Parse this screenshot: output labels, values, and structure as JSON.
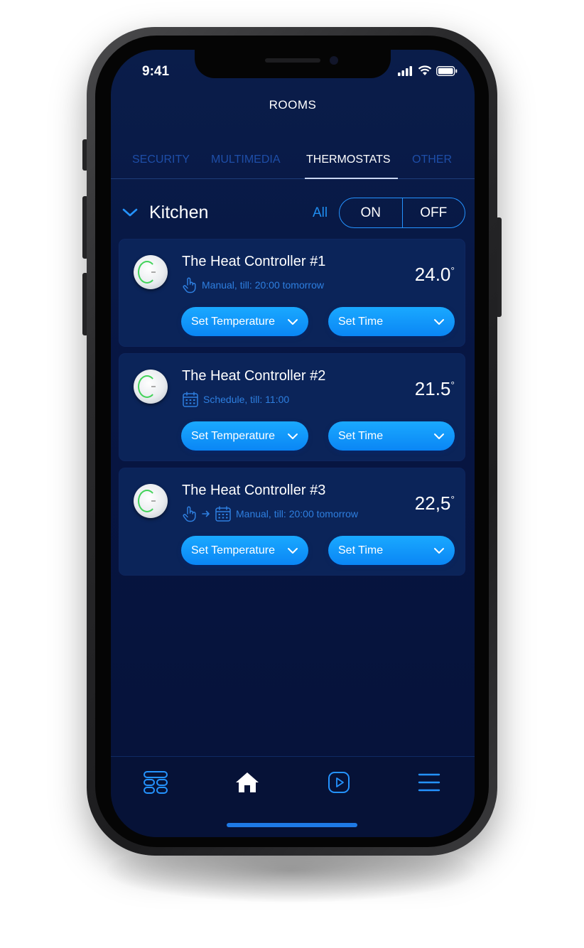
{
  "status_bar": {
    "time": "9:41"
  },
  "header": {
    "title": "ROOMS"
  },
  "tabs": [
    {
      "label": "SECURITY",
      "active": false
    },
    {
      "label": "MULTIMEDIA",
      "active": false
    },
    {
      "label": "THERMOSTATS",
      "active": true
    },
    {
      "label": "OTHER",
      "active": false
    }
  ],
  "room": {
    "name": "Kitchen",
    "filter_label": "All",
    "toggle": {
      "on_label": "ON",
      "off_label": "OFF"
    }
  },
  "devices": [
    {
      "name": "The Heat Controller #1",
      "temperature": "24.0",
      "degree": "°",
      "mode_icons": [
        "hand-pointer-icon"
      ],
      "mode_text": "Manual, till: 20:00 tomorrow",
      "set_temperature_label": "Set Temperature",
      "set_time_label": "Set Time"
    },
    {
      "name": "The Heat Controller #2",
      "temperature": "21.5",
      "degree": "°",
      "mode_icons": [
        "calendar-icon"
      ],
      "mode_text": "Schedule, till: 11:00",
      "set_temperature_label": "Set Temperature",
      "set_time_label": "Set Time"
    },
    {
      "name": "The Heat Controller #3",
      "temperature": "22,5",
      "degree": "°",
      "mode_icons": [
        "hand-pointer-icon",
        "arrow-right-icon",
        "calendar-icon"
      ],
      "mode_text": "Manual, till: 20:00 tomorrow",
      "set_temperature_label": "Set Temperature",
      "set_time_label": "Set Time"
    }
  ],
  "bottom_nav": [
    {
      "icon": "rooms-grid-icon",
      "active": false
    },
    {
      "icon": "home-icon",
      "active": true
    },
    {
      "icon": "media-play-icon",
      "active": false
    },
    {
      "icon": "menu-icon",
      "active": false
    }
  ],
  "colors": {
    "screen_bg": "#071643",
    "accent": "#1f8df0",
    "button": "#0a86f5",
    "inactive_tab": "#1e4ea8",
    "device_ring": "#43d35a"
  }
}
